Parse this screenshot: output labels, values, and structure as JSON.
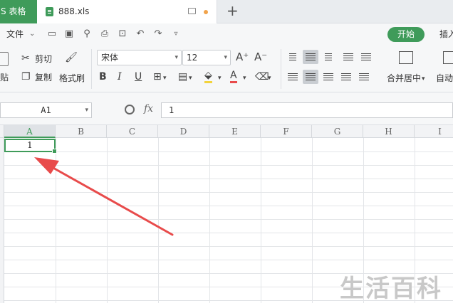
{
  "tabs": {
    "app_tab": "S 表格",
    "file_tab": "888.xls",
    "new_tab_symbol": "+"
  },
  "menu": {
    "file": "文件",
    "start": "开始",
    "insert": "插入"
  },
  "ribbon": {
    "paste": "贴",
    "cut": "剪切",
    "copy": "复制",
    "format_painter": "格式刷",
    "font_name": "宋体",
    "font_size": "12",
    "bold": "B",
    "italic": "I",
    "underline": "U",
    "merge_center": "合并居中",
    "auto_wrap": "自动"
  },
  "formula_bar": {
    "name_box": "A1",
    "fx": "fx",
    "value": "1"
  },
  "grid": {
    "columns": [
      "A",
      "B",
      "C",
      "D",
      "E",
      "F",
      "G",
      "H",
      "I"
    ],
    "selected_column": "A",
    "cell_a1": "1"
  },
  "watermark": "生活百科",
  "colors": {
    "accent": "#3f9b5a",
    "arrow": "#e84b4b",
    "dot": "#f1a34b"
  }
}
